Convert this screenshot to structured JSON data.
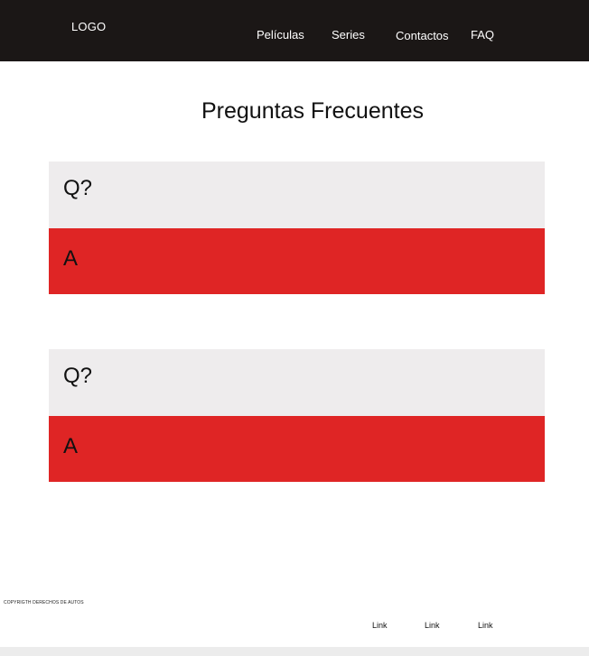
{
  "header": {
    "logo": "LOGO",
    "nav": [
      "Películas",
      "Series",
      "Contactos",
      "FAQ"
    ]
  },
  "main": {
    "title": "Preguntas Frecuentes",
    "faqs": [
      {
        "question": "Q?",
        "answer": "A"
      },
      {
        "question": "Q?",
        "answer": "A"
      }
    ]
  },
  "footer": {
    "copyright": "COPYRIGTH DERECHOS DE AUTOS",
    "links": [
      "Link",
      "Link",
      "Link"
    ]
  },
  "colors": {
    "header_bg": "#1b1716",
    "question_bg": "#eeeced",
    "answer_bg": "#df2525"
  }
}
